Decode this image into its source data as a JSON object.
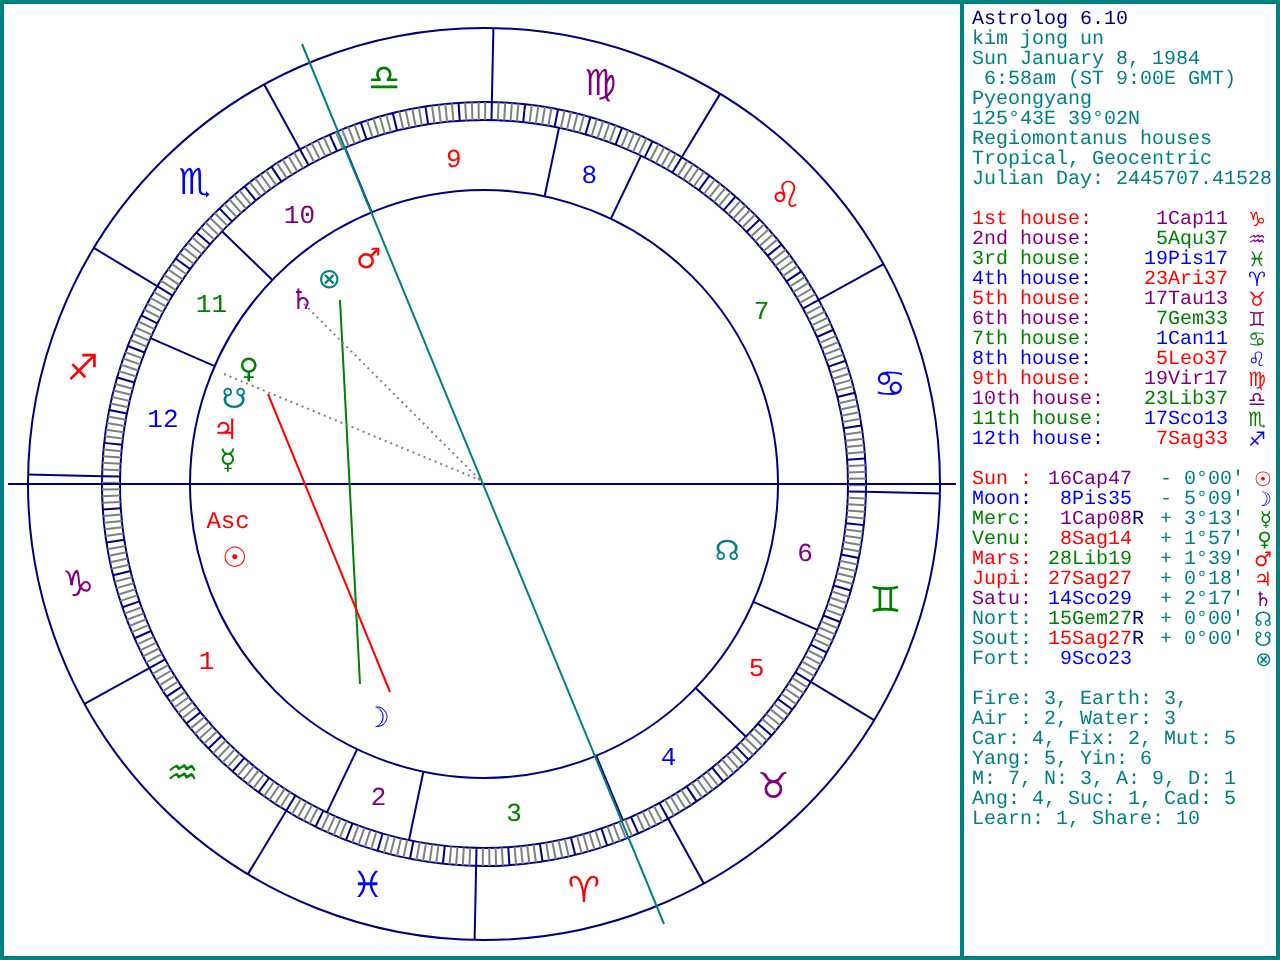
{
  "title": "Astrolog 6.10",
  "info": [
    "kim jong un",
    "Sun January 8, 1984",
    " 6:58am (ST 9:00E GMT)",
    "Pyeongyang",
    "125°43E 39°02N",
    "Regiomontanus houses",
    "Tropical, Geocentric",
    "Julian Day: 2445707.41528"
  ],
  "houses": [
    {
      "label": "1st house:",
      "value": {
        "text": "1Cap11",
        "color": "#800080"
      },
      "glyph": "♑",
      "color": "#ff0000"
    },
    {
      "label": "2nd house:",
      "value": {
        "text": "5Aqu37",
        "color": "#008000"
      },
      "glyph": "♒",
      "color": "#800080"
    },
    {
      "label": "3rd house:",
      "value": {
        "text": "19Pis17",
        "color": "#0000ff"
      },
      "glyph": "♓",
      "color": "#008000"
    },
    {
      "label": "4th house:",
      "value": {
        "text": "23Ari37",
        "color": "#ff0000"
      },
      "glyph": "♈",
      "color": "#0000ff"
    },
    {
      "label": "5th house:",
      "value": {
        "text": "17Tau13",
        "color": "#800080"
      },
      "glyph": "♉",
      "color": "#ff0000"
    },
    {
      "label": "6th house:",
      "value": {
        "text": "7Gem33",
        "color": "#008000"
      },
      "glyph": "♊",
      "color": "#800080"
    },
    {
      "label": "7th house:",
      "value": {
        "text": "1Can11",
        "color": "#0000ff"
      },
      "glyph": "♋",
      "color": "#008000"
    },
    {
      "label": "8th house:",
      "value": {
        "text": "5Leo37",
        "color": "#ff0000"
      },
      "glyph": "♌",
      "color": "#0000ff"
    },
    {
      "label": "9th house:",
      "value": {
        "text": "19Vir17",
        "color": "#800080"
      },
      "glyph": "♍",
      "color": "#ff0000"
    },
    {
      "label": "10th house:",
      "value": {
        "text": "23Lib37",
        "color": "#008000"
      },
      "glyph": "♎",
      "color": "#800080"
    },
    {
      "label": "11th house:",
      "value": {
        "text": "17Sco13",
        "color": "#0000ff"
      },
      "glyph": "♏",
      "color": "#008000"
    },
    {
      "label": "12th house:",
      "value": {
        "text": "7Sag33",
        "color": "#ff0000"
      },
      "glyph": "♐",
      "color": "#0000ff"
    }
  ],
  "planets": [
    {
      "name": "Sun :",
      "value": {
        "text": "16Cap47",
        "color": "#800080"
      },
      "lat": "- 0°00'",
      "glyph": "☉",
      "color": "#ff0000"
    },
    {
      "name": "Moon:",
      "value": {
        "text": "8Pis35",
        "color": "#0000ff"
      },
      "lat": "- 5°09'",
      "glyph": "☽",
      "color": "#0000ff"
    },
    {
      "name": "Merc:",
      "value": {
        "text": "1Cap08",
        "color": "#800080"
      },
      "flag": "R",
      "lat": "+ 3°13'",
      "glyph": "☿",
      "color": "#008000"
    },
    {
      "name": "Venu:",
      "value": {
        "text": "8Sag14",
        "color": "#ff0000"
      },
      "lat": "+ 1°57'",
      "glyph": "♀",
      "color": "#008000"
    },
    {
      "name": "Mars:",
      "value": {
        "text": "28Lib19",
        "color": "#008000"
      },
      "lat": "+ 1°39'",
      "glyph": "♂",
      "color": "#ff0000"
    },
    {
      "name": "Jupi:",
      "value": {
        "text": "27Sag27",
        "color": "#ff0000"
      },
      "lat": "+ 0°18'",
      "glyph": "♃",
      "color": "#ff0000"
    },
    {
      "name": "Satu:",
      "value": {
        "text": "14Sco29",
        "color": "#0000ff"
      },
      "lat": "+ 2°17'",
      "glyph": "♄",
      "color": "#800080"
    },
    {
      "name": "Nort:",
      "value": {
        "text": "15Gem27",
        "color": "#008000"
      },
      "flag": "R",
      "lat": "+ 0°00'",
      "glyph": "☊",
      "color": "#008080"
    },
    {
      "name": "Sout:",
      "value": {
        "text": "15Sag27",
        "color": "#ff0000"
      },
      "flag": "R",
      "lat": "+ 0°00'",
      "glyph": "☋",
      "color": "#008080"
    },
    {
      "name": "Fort:",
      "value": {
        "text": "9Sco23",
        "color": "#0000ff"
      },
      "glyph": "⊗",
      "color": "#008080"
    }
  ],
  "stats": [
    "Fire: 3, Earth: 3,",
    "Air : 2, Water: 3",
    "Car: 4, Fix: 2, Mut: 5",
    "Yang: 5, Yin: 6",
    "M: 7, N: 3, A: 9, D: 1",
    "Ang: 4, Suc: 1, Cad: 5",
    "Learn: 1, Share: 10"
  ],
  "wheel": {
    "signs": [
      {
        "glyph": "♈",
        "color": "#ff0000"
      },
      {
        "glyph": "♉",
        "color": "#800080"
      },
      {
        "glyph": "♊",
        "color": "#008000"
      },
      {
        "glyph": "♋",
        "color": "#0000ff"
      },
      {
        "glyph": "♌",
        "color": "#ff0000"
      },
      {
        "glyph": "♍",
        "color": "#800080"
      },
      {
        "glyph": "♎",
        "color": "#008000"
      },
      {
        "glyph": "♏",
        "color": "#0000ff"
      },
      {
        "glyph": "♐",
        "color": "#ff0000"
      },
      {
        "glyph": "♑",
        "color": "#800080"
      },
      {
        "glyph": "♒",
        "color": "#008000"
      },
      {
        "glyph": "♓",
        "color": "#0000ff"
      }
    ],
    "house_numbers": [
      {
        "label": "1",
        "color": "#ff0000"
      },
      {
        "label": "2",
        "color": "#800080"
      },
      {
        "label": "3",
        "color": "#008000"
      },
      {
        "label": "4",
        "color": "#0000ff"
      },
      {
        "label": "5",
        "color": "#ff0000"
      },
      {
        "label": "6",
        "color": "#800080"
      },
      {
        "label": "7",
        "color": "#008000"
      },
      {
        "label": "8",
        "color": "#0000ff"
      },
      {
        "label": "9",
        "color": "#ff0000"
      },
      {
        "label": "10",
        "color": "#800080"
      },
      {
        "label": "11",
        "color": "#008000"
      },
      {
        "label": "12",
        "color": "#0000ff"
      }
    ],
    "planets": [
      {
        "glyph": "☉",
        "color": "#ff0000"
      },
      {
        "glyph": "☽",
        "color": "#0000ff"
      },
      {
        "glyph": "☿",
        "color": "#008000"
      },
      {
        "glyph": "♀",
        "color": "#008000"
      },
      {
        "glyph": "♂",
        "color": "#ff0000"
      },
      {
        "glyph": "♃",
        "color": "#ff0000"
      },
      {
        "glyph": "♄",
        "color": "#800080"
      },
      {
        "glyph": "☊",
        "color": "#008080"
      },
      {
        "glyph": "☋",
        "color": "#008080"
      },
      {
        "glyph": "⊗",
        "color": "#008080"
      }
    ],
    "asc_label": "Asc"
  }
}
